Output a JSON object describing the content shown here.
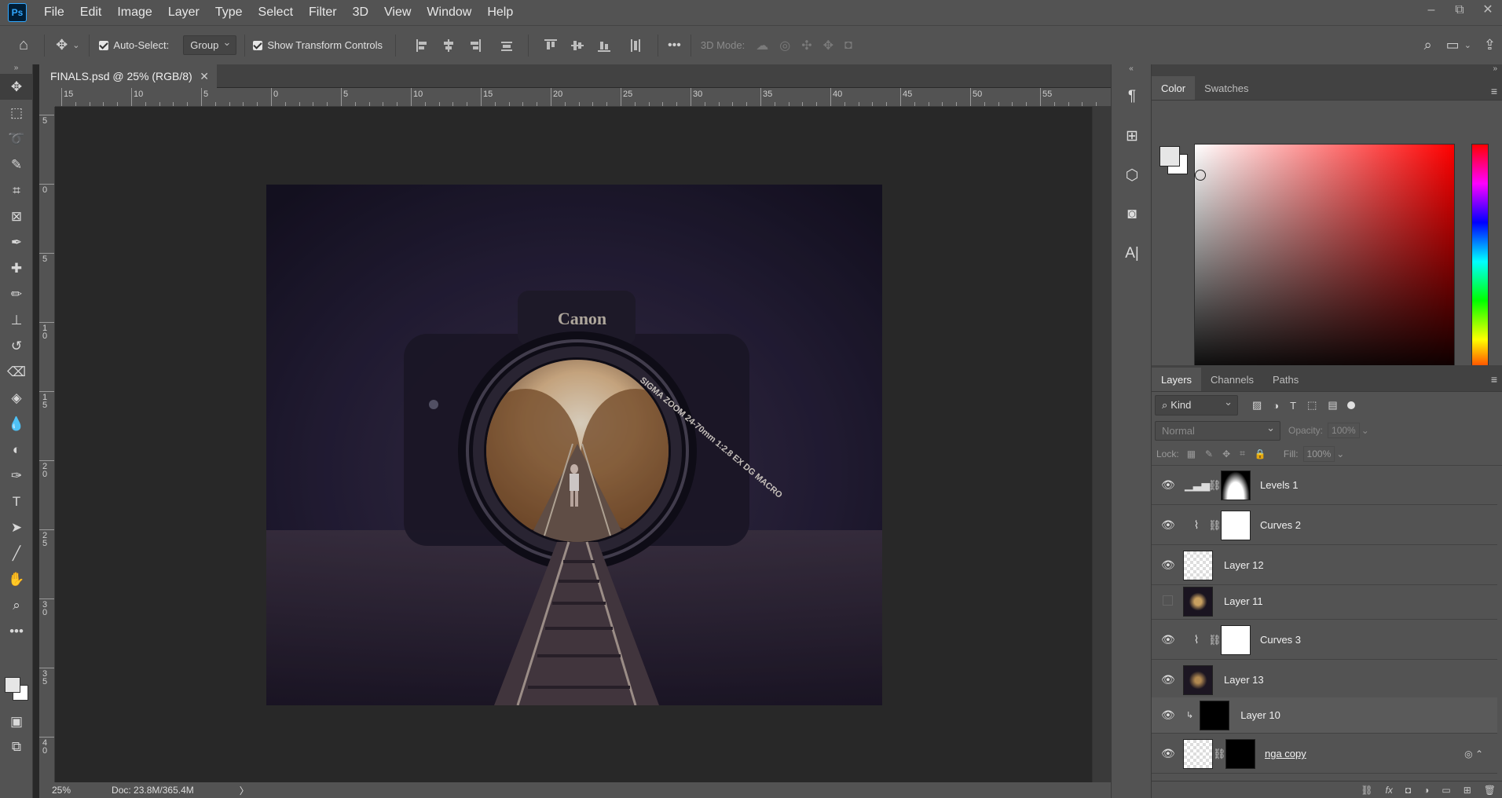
{
  "app": {
    "logo": "Ps"
  },
  "menu": [
    "File",
    "Edit",
    "Image",
    "Layer",
    "Type",
    "Select",
    "Filter",
    "3D",
    "View",
    "Window",
    "Help"
  ],
  "window_controls": [
    "–",
    "⧉",
    "✕"
  ],
  "options": {
    "auto_select_label": "Auto-Select:",
    "auto_select_value": "Group",
    "show_transform_label": "Show Transform Controls",
    "mode_3d_label": "3D Mode:"
  },
  "document": {
    "tab_title": "FINALS.psd @ 25% (RGB/8)",
    "close": "✕"
  },
  "ruler": {
    "h_labels": [
      "15",
      "10",
      "5",
      "0",
      "5",
      "10",
      "15",
      "20",
      "25",
      "30",
      "35",
      "40",
      "45",
      "50",
      "55"
    ],
    "v_labels": [
      "5",
      "0",
      "5",
      "1\n0",
      "1\n5",
      "2\n0",
      "2\n5",
      "3\n0",
      "3\n5",
      "4\n0"
    ]
  },
  "status": {
    "zoom": "25%",
    "doc": "Doc: 23.8M/365.4M",
    "arrow": "〉"
  },
  "artwork": {
    "brand": "Canon",
    "lens_text": "SIGMA ZOOM 24-70mm 1:2.8 EX DG MACRO"
  },
  "color_panel": {
    "tabs": [
      "Color",
      "Swatches"
    ],
    "active": "Color"
  },
  "layers_panel": {
    "tabs": [
      "Layers",
      "Channels",
      "Paths"
    ],
    "active": "Layers",
    "filter_kind": "Kind",
    "blend_mode": "Normal",
    "opacity_label": "Opacity:",
    "opacity_value": "100%",
    "lock_label": "Lock:",
    "fill_label": "Fill:",
    "fill_value": "100%",
    "layers": [
      {
        "name": "Levels 1",
        "visible": true
      },
      {
        "name": "Curves 2",
        "visible": true
      },
      {
        "name": "Layer 12",
        "visible": true
      },
      {
        "name": "Layer 11",
        "visible": false
      },
      {
        "name": "Curves 3",
        "visible": true
      },
      {
        "name": "Layer 13",
        "visible": true
      },
      {
        "name": "Layer 10",
        "visible": true
      },
      {
        "name": "nga copy",
        "visible": true
      }
    ]
  },
  "colors": {
    "accent": "#31a8ff",
    "panel": "#535353",
    "canvas": "#282828"
  }
}
